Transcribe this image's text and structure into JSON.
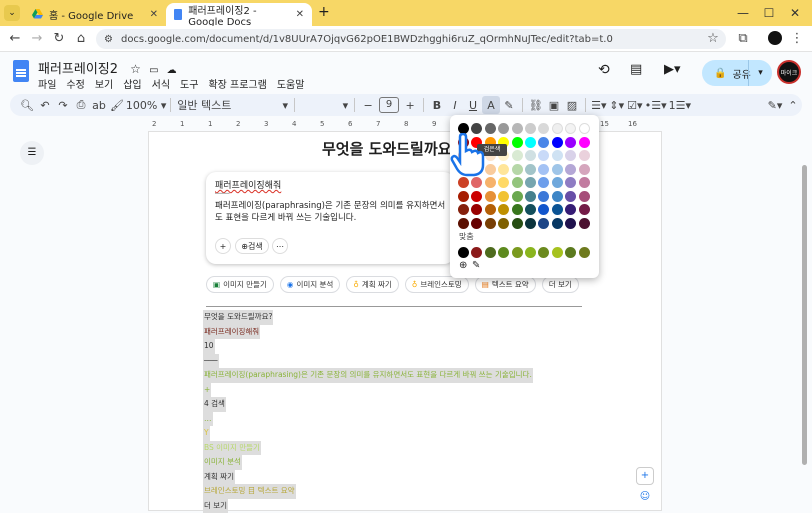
{
  "tabs": [
    {
      "label": "홈 - Google Drive",
      "active": false
    },
    {
      "label": "패러프레이징2 - Google Docs",
      "active": true
    }
  ],
  "window_controls": {
    "minimize": "—",
    "maximize": "☐",
    "close": "✕",
    "new_tab": "+"
  },
  "address": {
    "url": "docs.google.com/document/d/1v8UUrA7OjqvG62pOE1BWDzhgghi6ruZ_qOrmhNuJTec/edit?tab=t.0"
  },
  "doc": {
    "title": "패러프레이징2",
    "menus": [
      "파일",
      "수정",
      "보기",
      "삽입",
      "서식",
      "도구",
      "확장 프로그램",
      "도움말"
    ],
    "share_label": "공유",
    "avatar_text": "마이크"
  },
  "toolbar": {
    "zoom": "100%",
    "style": "일반 텍스트",
    "font_size": "9",
    "bold": "B",
    "italic": "I",
    "underline": "U",
    "text_color": "A"
  },
  "ruler_ticks": [
    "2",
    "1",
    "1",
    "2",
    "3",
    "4",
    "5",
    "6",
    "7",
    "8",
    "9",
    "10",
    "11",
    "12",
    "13",
    "14",
    "15",
    "16"
  ],
  "content": {
    "heading": "무엇을 도와드릴까요?",
    "card_title": "패러프레이징해줘",
    "card_sep": "───",
    "card_body": "패러프레이징(paraphrasing)은 기존 문장의 의미를 유지하면서도 표현을 다르게 바꿔 쓰는 기술입니다.",
    "card_search": "검색",
    "chips": [
      "이미지 만들기",
      "이미지 분석",
      "계획 짜기",
      "브레인스토밍",
      "텍스트 요약",
      "더 보기"
    ],
    "lines": [
      {
        "text": "무엇을 도와드릴까요?",
        "color": "#333333"
      },
      {
        "text": "패러프레이징해줘",
        "color": "#7a2b20"
      },
      {
        "text": "10",
        "color": "#333333"
      },
      {
        "text": "───",
        "color": "#333333"
      },
      {
        "text": "패러프레이징(paraphrasing)은 기존 문장의 의미를 유지하면서도 표현을 다르게 바꿔 쓰는 기술입니다.",
        "color": "#8ab33a"
      },
      {
        "text": "+",
        "color": "#8ab33a"
      },
      {
        "text": "4 검색",
        "color": "#333333"
      },
      {
        "text": "…",
        "color": "#8ab33a"
      },
      {
        "text": "Y",
        "color": "#d9c23a"
      },
      {
        "text": "BS 이미지 만들기",
        "color": "#b8d86a"
      },
      {
        "text": "이미지 분석",
        "color": "#8ab33a"
      },
      {
        "text": "계획 짜기",
        "color": "#333333"
      },
      {
        "text": "브레인스토밍 目 텍스트 요약",
        "color": "#b8a83a"
      },
      {
        "text": "더 보기",
        "color": "#333333"
      }
    ]
  },
  "palette": {
    "tooltip": "검은색",
    "custom_label": "맞춤",
    "rows": [
      [
        "#000000",
        "#434343",
        "#666666",
        "#999999",
        "#b7b7b7",
        "#cccccc",
        "#d9d9d9",
        "#efefef",
        "#f3f3f3",
        "#ffffff"
      ],
      [
        "#980000",
        "#ff0000",
        "#ff9900",
        "#ffff00",
        "#00ff00",
        "#00ffff",
        "#4a86e8",
        "#0000ff",
        "#9900ff",
        "#ff00ff"
      ],
      [
        "#e6b8af",
        "#f4cccc",
        "#fce5cd",
        "#fff2cc",
        "#d9ead3",
        "#d0e0e3",
        "#c9daf8",
        "#cfe2f3",
        "#d9d2e9",
        "#ead1dc"
      ],
      [
        "#dd7e6b",
        "#ea9999",
        "#f9cb9c",
        "#ffe599",
        "#b6d7a8",
        "#a2c4c9",
        "#a4c2f4",
        "#9fc5e8",
        "#b4a7d6",
        "#d5a6bd"
      ],
      [
        "#cc4125",
        "#e06666",
        "#f6b26b",
        "#ffd966",
        "#93c47d",
        "#76a5af",
        "#6d9eeb",
        "#6fa8dc",
        "#8e7cc3",
        "#c27ba0"
      ],
      [
        "#a61c00",
        "#cc0000",
        "#e69138",
        "#f1c232",
        "#6aa84f",
        "#45818e",
        "#3c78d8",
        "#3d85c6",
        "#674ea7",
        "#a64d79"
      ],
      [
        "#85200c",
        "#990000",
        "#b45f06",
        "#bf9000",
        "#38761d",
        "#134f5c",
        "#1155cc",
        "#0b5394",
        "#351c75",
        "#741b47"
      ],
      [
        "#5b0f00",
        "#660000",
        "#783f04",
        "#7f6000",
        "#274e13",
        "#0c343d",
        "#1c4587",
        "#073763",
        "#20124d",
        "#4c1130"
      ]
    ],
    "custom": [
      "#000000",
      "#8b1a1a",
      "#4e6b1e",
      "#5d8a1e",
      "#7a9a1e",
      "#8ab51e",
      "#6b8a1e",
      "#a6c21e",
      "#5b7a1e",
      "#6e7a1e"
    ]
  }
}
